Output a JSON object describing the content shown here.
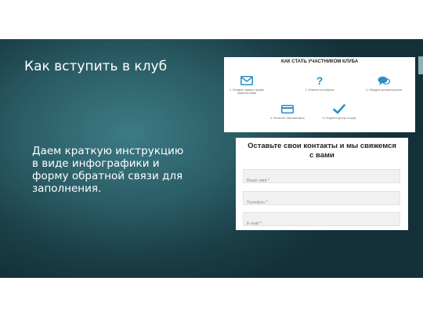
{
  "slide": {
    "title": "Как вступить в клуб",
    "body": "Даем краткую инструкцию в виде инфографики и форму обратной связи для заполнения."
  },
  "infographic": {
    "title": "КАК СТАТЬ УЧАСТНИКОМ КЛУБА",
    "steps": [
      {
        "icon": "envelope-icon",
        "caption": "1. Оставьте заявку в форме обратной связи"
      },
      {
        "icon": "question-icon",
        "caption": "2. Ответьте на вопросы"
      },
      {
        "icon": "chat-icon",
        "caption": "3. Обсудите условия участия"
      },
      {
        "icon": "card-icon",
        "caption": "4. Оплатите членский взнос"
      },
      {
        "icon": "checkmark-icon",
        "caption": "5. Получите доступ к клубу"
      }
    ]
  },
  "form": {
    "heading_line1": "Оставьте свои контакты и мы свяжемся",
    "heading_line2": "с вами",
    "name_placeholder": "Ваше имя *",
    "phone_placeholder": "Телефон *",
    "email_placeholder": "E-mail *"
  },
  "colors": {
    "slide_bg": "#2a5c65",
    "accent_bar": "#8fb0b4",
    "icon_blue": "#2a8fc9"
  }
}
